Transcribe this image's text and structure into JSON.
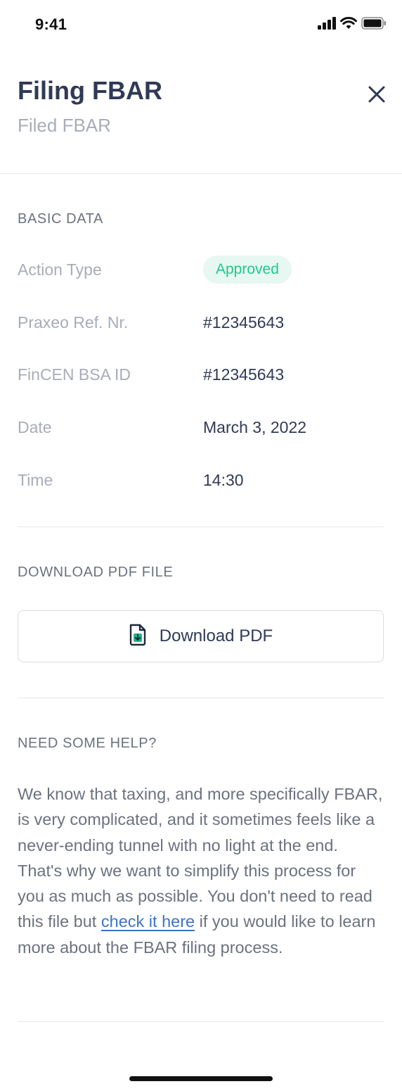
{
  "status_bar": {
    "time": "9:41",
    "icons": [
      "signal-icon",
      "wifi-icon",
      "battery-icon"
    ]
  },
  "header": {
    "title": "Filing FBAR",
    "subtitle": "Filed FBAR",
    "close_icon": "close-icon"
  },
  "basic_data": {
    "section_title": "BASIC DATA",
    "rows": [
      {
        "label": "Action Type",
        "value": "Approved",
        "type": "badge"
      },
      {
        "label": "Praxeo Ref. Nr.",
        "value": "#12345643"
      },
      {
        "label": "FinCEN BSA ID",
        "value": "#12345643"
      },
      {
        "label": "Date",
        "value": "March 3, 2022"
      },
      {
        "label": "Time",
        "value": "14:30"
      }
    ]
  },
  "download": {
    "section_title": "DOWNLOAD PDF FILE",
    "button_label": "Download PDF",
    "icon": "pdf-download-icon"
  },
  "help": {
    "section_title": "NEED SOME HELP?",
    "text_before": "We know that taxing, and more specifically FBAR, is very complicated, and it sometimes feels like a never-ending tunnel with no light at the end. That's why we want to simplify this process for you as much as possible. You don't need to read this file but ",
    "link_text": "check it here",
    "text_after": " if you would like to learn more about the FBAR filing process."
  },
  "colors": {
    "title": "#2f3a57",
    "muted": "#a8adb8",
    "body": "#6b7280",
    "badge_bg": "#e6f8f1",
    "badge_text": "#1fc98e",
    "link": "#3b74c9",
    "divider": "#e6e8ec"
  }
}
